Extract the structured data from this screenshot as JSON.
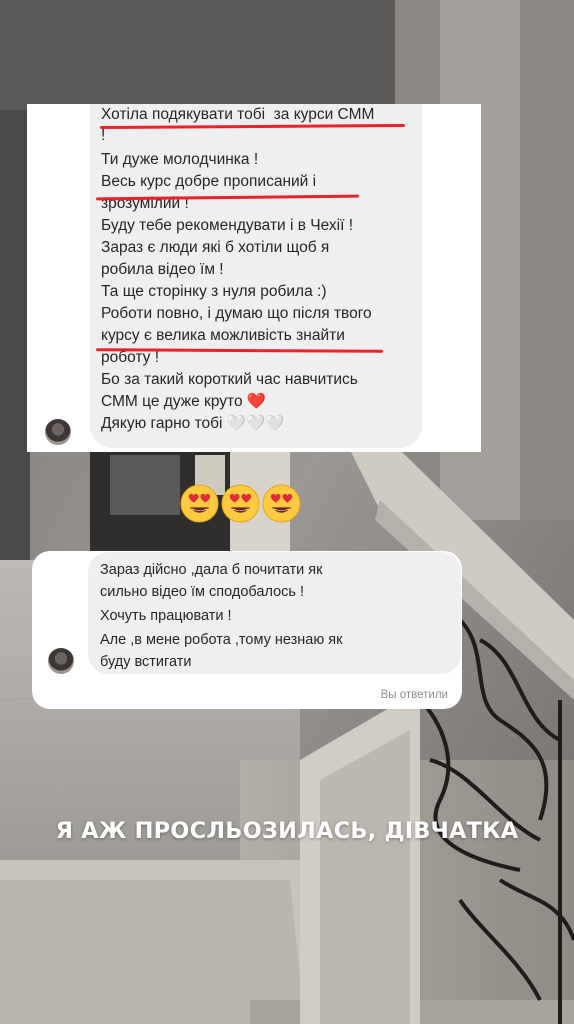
{
  "message1": {
    "lines": [
      "Хотіла подякувати тобі  за курси СММ",
      "!",
      "Ти дуже молодчинка !",
      "Весь курс добре прописаний і",
      "зрозумілий !",
      "Буду тебе рекомендувати і в Чехії !",
      "Зараз є люди які б хотіли щоб я",
      "робила відео їм !",
      "Та ще сторінку з нуля робила :)",
      "Роботи повно, і думаю що після твого",
      "курсу є велика можливість знайти",
      "роботу !",
      "Бо за такий короткий час навчитись",
      "СММ це дуже круто ❤️",
      "Дякую гарно тобі 🤍🤍🤍"
    ]
  },
  "reaction": {
    "emojis": [
      "😍",
      "😍",
      "😍"
    ]
  },
  "message2": {
    "lines": [
      "Зараз дійсно ,дала б почитати як",
      "сильно відео їм сподобалось !",
      "Хочуть працювати !",
      "Але ,в мене робота ,тому незнаю як",
      "буду встигати"
    ],
    "reply_label": "Вы ответили"
  },
  "caption": "Я АЖ ПРОСЛЬОЗИЛАСЬ, ДІВЧАТКА",
  "colors": {
    "underline": "#e3262b",
    "bubble": "#efefef",
    "text": "#262626"
  }
}
